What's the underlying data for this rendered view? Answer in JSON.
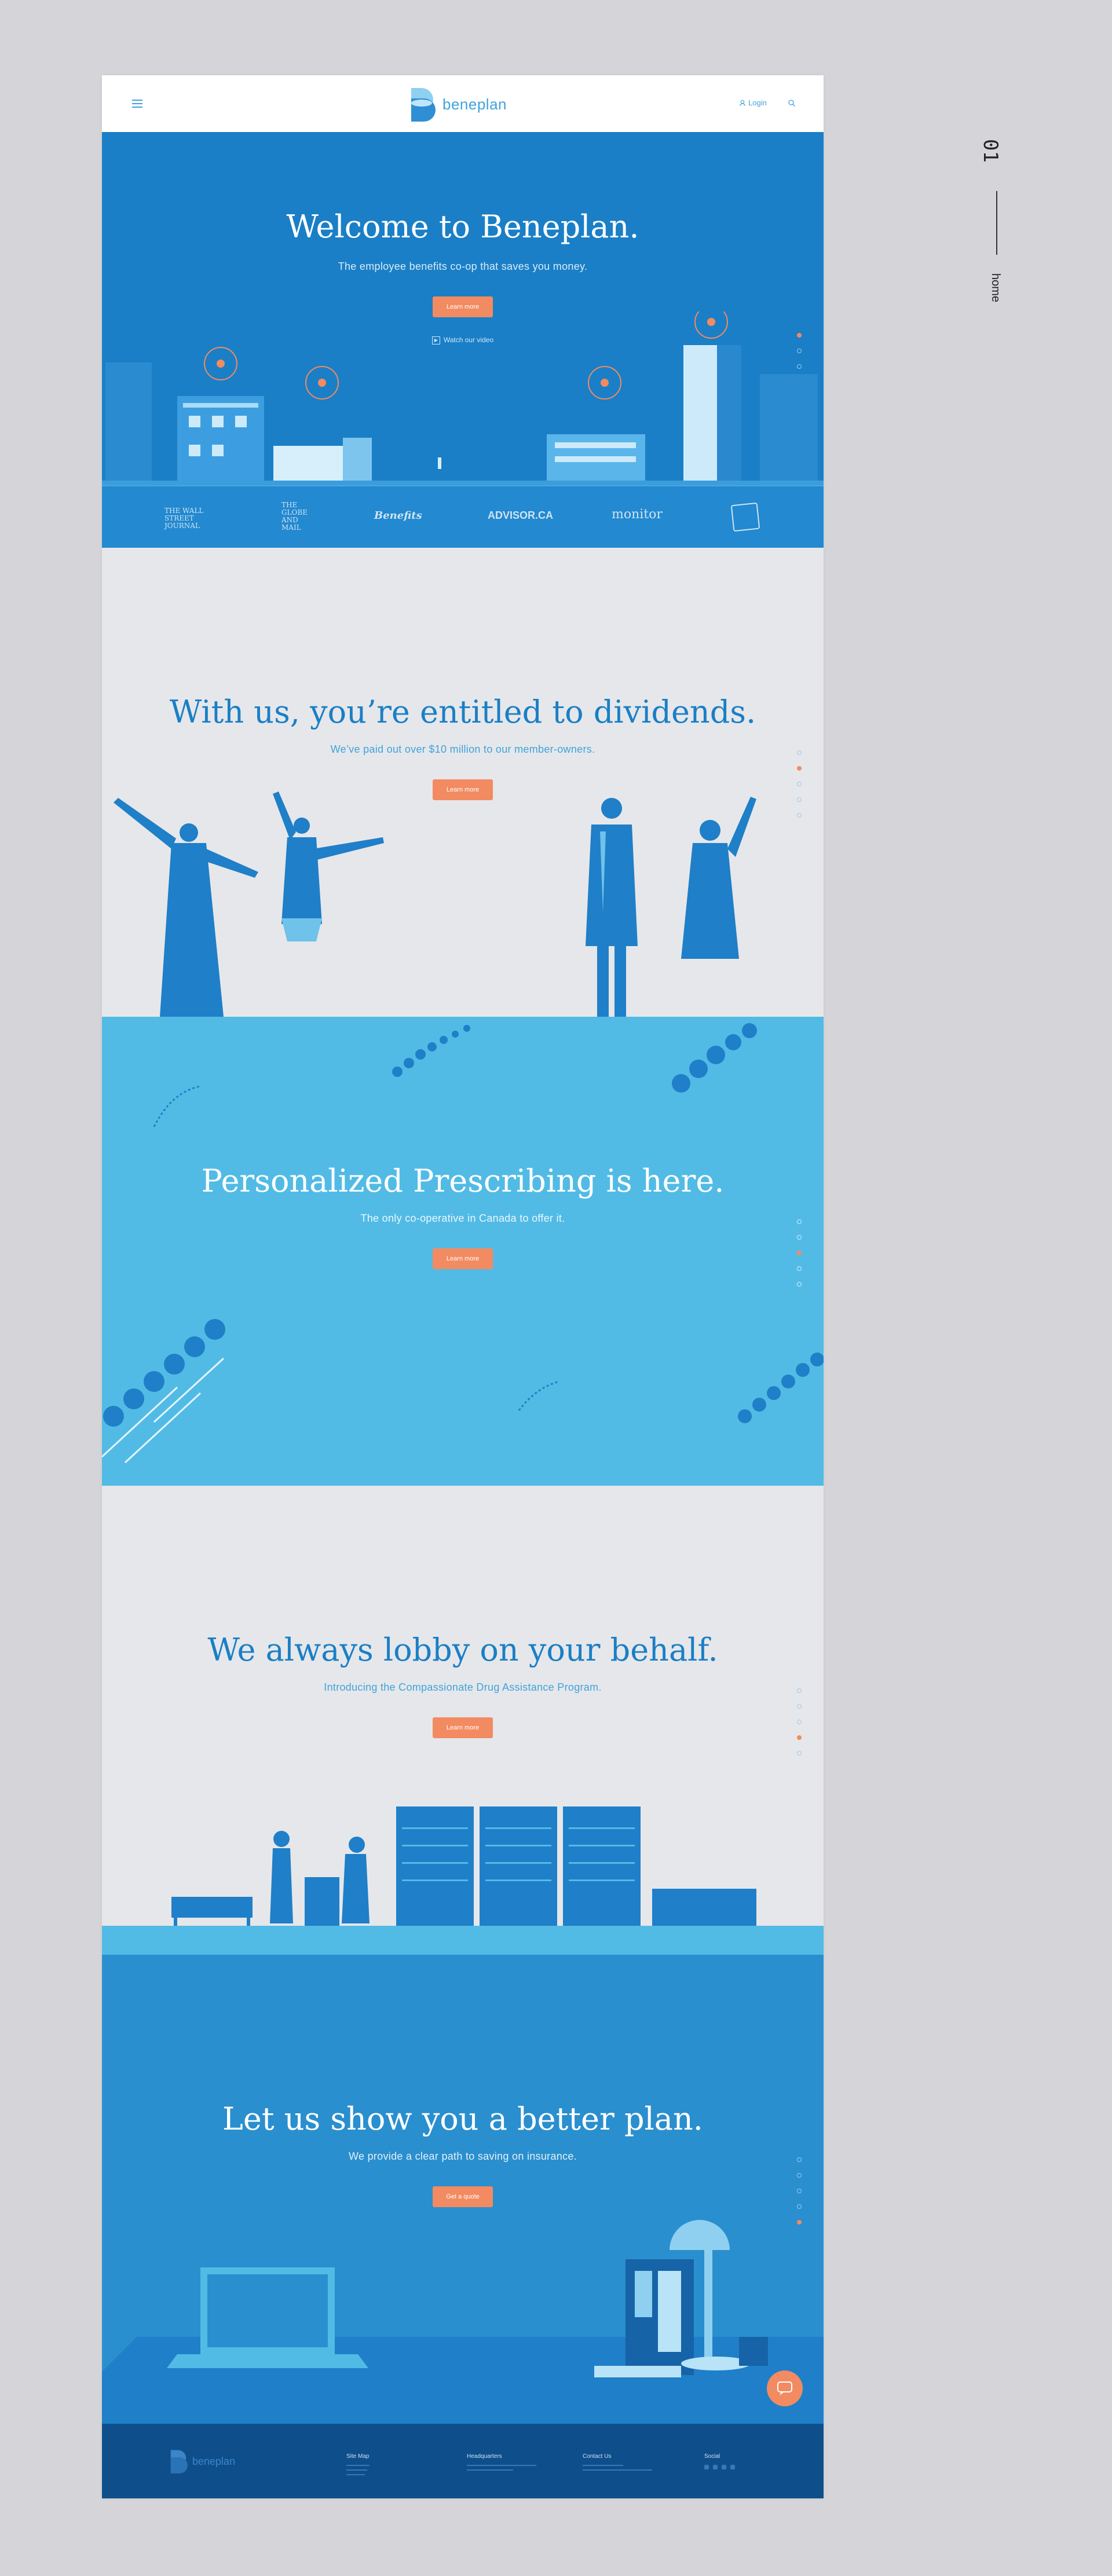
{
  "side": {
    "number": "01",
    "label": "home"
  },
  "header": {
    "brand": "beneplan",
    "login": "Login",
    "icons": [
      "menu-icon",
      "search-icon",
      "user-icon"
    ]
  },
  "hero": {
    "title": "Welcome to Beneplan.",
    "subtitle": "The employee benefits co-op that saves you money.",
    "button": "Learn more",
    "video": "Watch our video",
    "press": [
      "THE WALL STREET JOURNAL",
      "THE GLOBE AND MAIL",
      "Benefits",
      "ADVISOR.CA",
      "monitor"
    ]
  },
  "dividends": {
    "title": "With us, you’re entitled to dividends.",
    "subtitle": "We’ve paid out over $10 million to our member-owners.",
    "button": "Learn more"
  },
  "prescribing": {
    "title": "Personalized Prescribing is here.",
    "subtitle": "The only co-operative in Canada to offer it.",
    "button": "Learn more"
  },
  "lobby": {
    "title": "We always lobby on your behalf.",
    "subtitle": "Introducing the Compassionate Drug Assistance Program.",
    "button": "Learn more"
  },
  "plan": {
    "title": "Let us show you a better plan.",
    "subtitle": "We provide a clear path to saving on insurance.",
    "button": "Get a quote"
  },
  "footer": {
    "brand": "beneplan",
    "sitemap_title": "Site Map",
    "hq_title": "Headquarters",
    "contact_title": "Contact Us",
    "social_title": "Social"
  },
  "colors": {
    "accent": "#f28b61",
    "brand": "#1a7fc6",
    "light": "#52bbe5"
  }
}
